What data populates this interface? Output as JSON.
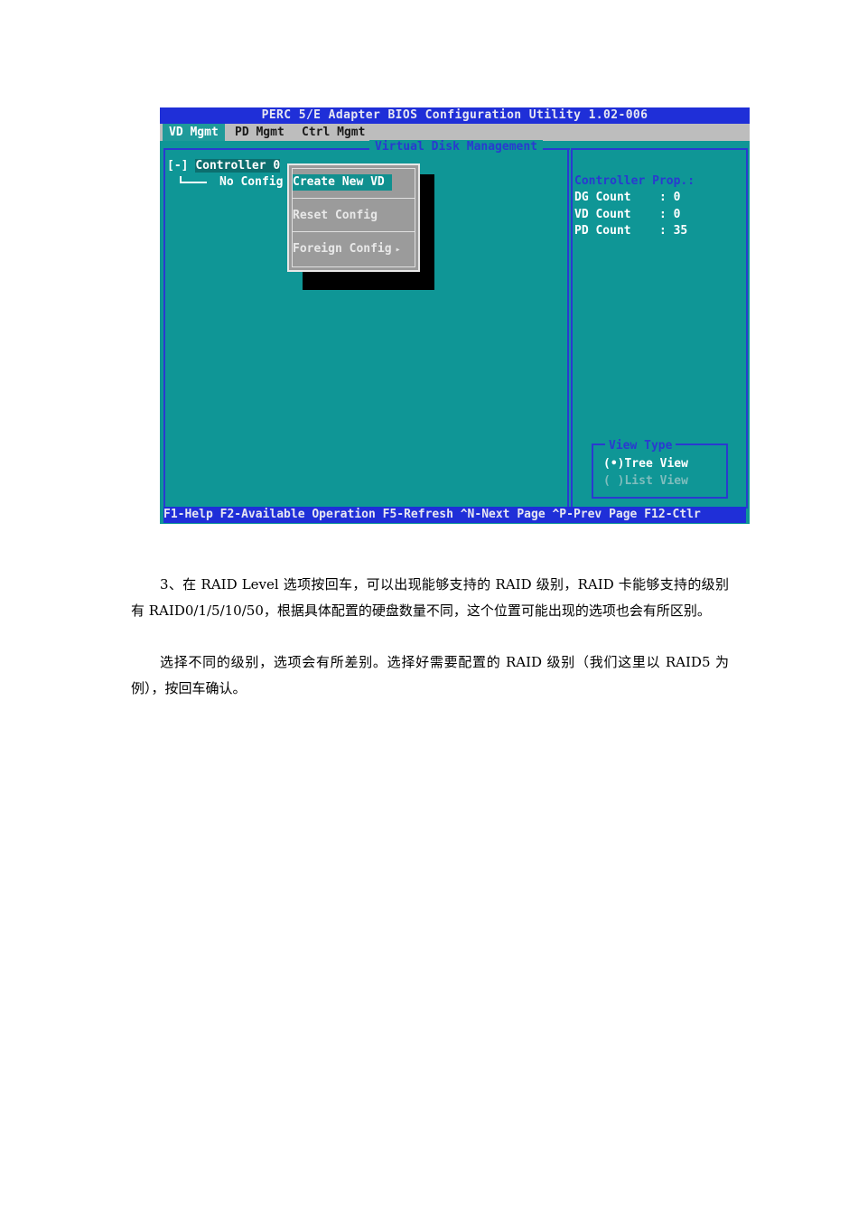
{
  "bios": {
    "title": "PERC 5/E Adapter BIOS Configuration Utility 1.02-006",
    "tabs": [
      "VD Mgmt",
      "PD Mgmt",
      "Ctrl Mgmt"
    ],
    "frame_title": "Virtual Disk Management",
    "tree": {
      "root_prefix": "[-] ",
      "root_label": "Controller 0",
      "child_label": "No Config"
    },
    "popup": {
      "items": [
        "Create New VD",
        "Reset Config",
        "Foreign Config"
      ],
      "submenu_arrow": "▸"
    },
    "props": {
      "header": "Controller Prop.:",
      "rows": [
        {
          "label": "DG Count",
          "value": ": 0"
        },
        {
          "label": "VD Count",
          "value": ": 0"
        },
        {
          "label": "PD Count",
          "value": ": 35"
        }
      ]
    },
    "view_type": {
      "title": "View Type",
      "options": [
        "(•)Tree View",
        "( )List View"
      ]
    },
    "status_bar": "F1-Help F2-Available Operation F5-Refresh ^N-Next Page ^P-Prev Page F12-Ctlr"
  },
  "doc": {
    "para1": "3、在 RAID Level 选项按回车，可以出现能够支持的 RAID 级别，RAID 卡能够支持的级别有 RAID0/1/5/10/50，根据具体配置的硬盘数量不同，这个位置可能出现的选项也会有所区别。",
    "para2": "选择不同的级别，选项会有所差别。选择好需要配置的 RAID 级别（我们这里以 RAID5 为例），按回车确认。"
  }
}
